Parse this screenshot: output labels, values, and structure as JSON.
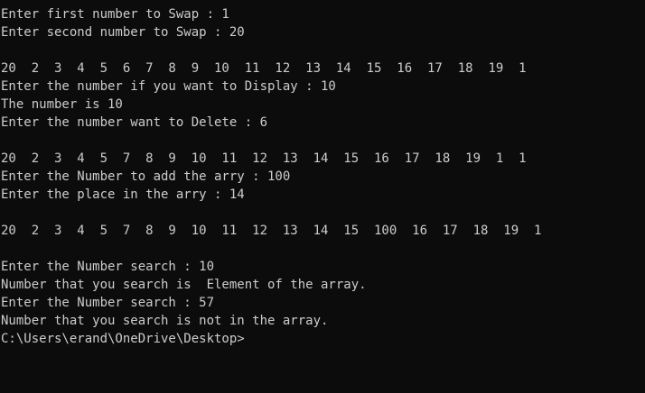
{
  "terminal": {
    "background": "#0c0c0c",
    "foreground": "#cccccc",
    "lines": [
      "Enter first number to Swap : 1",
      "Enter second number to Swap : 20",
      "",
      "20  2  3  4  5  6  7  8  9  10  11  12  13  14  15  16  17  18  19  1",
      "Enter the number if you want to Display : 10",
      "The number is 10",
      "Enter the number want to Delete : 6",
      "",
      "20  2  3  4  5  7  8  9  10  11  12  13  14  15  16  17  18  19  1  1",
      "Enter the Number to add the arry : 100",
      "Enter the place in the arry : 14",
      "",
      "20  2  3  4  5  7  8  9  10  11  12  13  14  15  100  16  17  18  19  1",
      "",
      "Enter the Number search : 10",
      "Number that you search is  Element of the array.",
      "Enter the Number search : 57",
      "Number that you search is not in the array.",
      "C:\\Users\\erand\\OneDrive\\Desktop>"
    ]
  }
}
